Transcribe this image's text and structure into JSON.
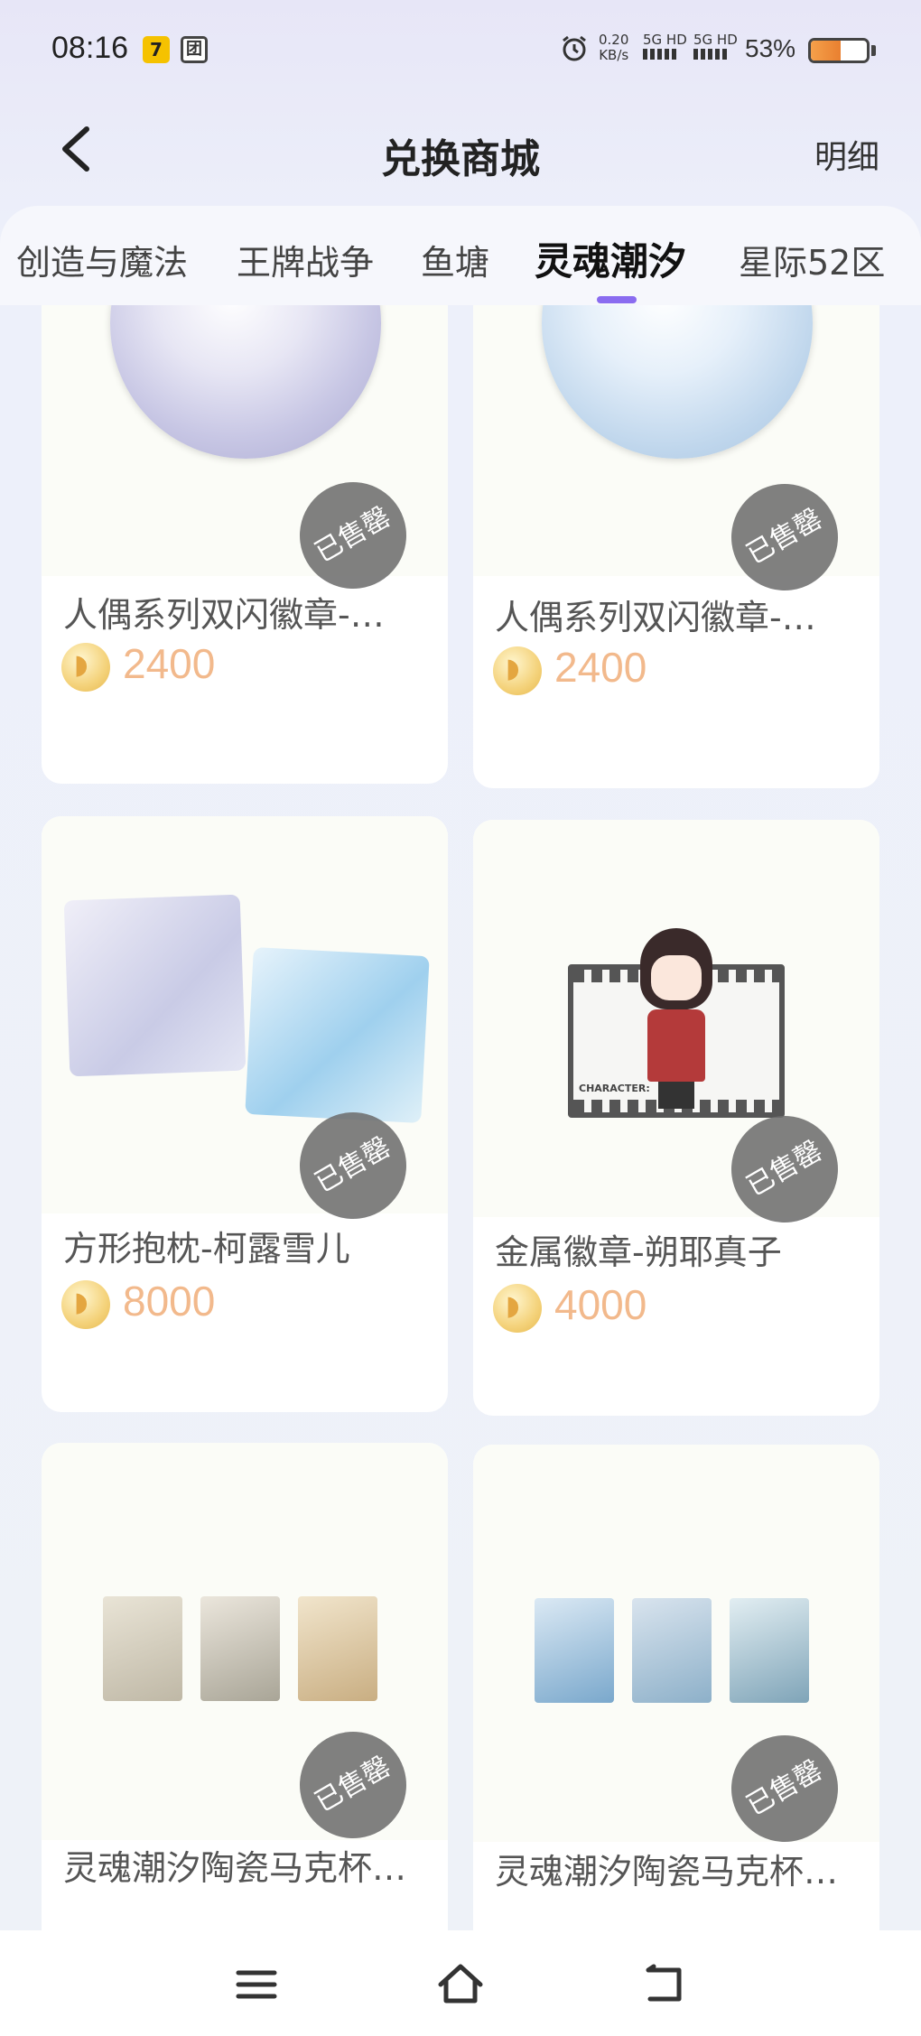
{
  "status_bar": {
    "time": "08:16",
    "app_badge_1": "7",
    "app_badge_2": "团",
    "net_speed_value": "0.20",
    "net_speed_unit": "KB/s",
    "signal_1": "5G HD",
    "signal_2": "5G HD",
    "battery_percent": "53%",
    "battery_level": 0.53
  },
  "header": {
    "title": "兑换商城",
    "detail_link": "明细"
  },
  "tabs": [
    {
      "label": "创造与魔法",
      "active": false
    },
    {
      "label": "王牌战争",
      "active": false
    },
    {
      "label": "鱼塘",
      "active": false
    },
    {
      "label": "灵魂潮汐",
      "active": true
    },
    {
      "label": "星际52区",
      "active": false
    }
  ],
  "sold_out_label": "已售罄",
  "products": [
    {
      "name": "人偶系列双闪徽章-…",
      "price": "2400",
      "sold_out": true
    },
    {
      "name": "人偶系列双闪徽章-…",
      "price": "2400",
      "sold_out": true
    },
    {
      "name": "方形抱枕-柯露雪儿",
      "price": "8000",
      "sold_out": true
    },
    {
      "name": "金属徽章-朔耶真子",
      "price": "4000",
      "sold_out": true
    },
    {
      "name": "灵魂潮汐陶瓷马克杯…",
      "price": "",
      "sold_out": true
    },
    {
      "name": "灵魂潮汐陶瓷马克杯…",
      "price": "",
      "sold_out": true
    }
  ],
  "product_art_text": {
    "film_label": "CHARACTER:"
  },
  "colors": {
    "accent": "#8a6cf0",
    "price": "#f2b98c",
    "sold_badge": "#6e6e6e"
  },
  "icons": {
    "back": "chevron-left-icon",
    "coin": "fish-coin-icon",
    "nav_menu": "menu-icon",
    "nav_home": "home-icon",
    "nav_back": "return-icon"
  }
}
